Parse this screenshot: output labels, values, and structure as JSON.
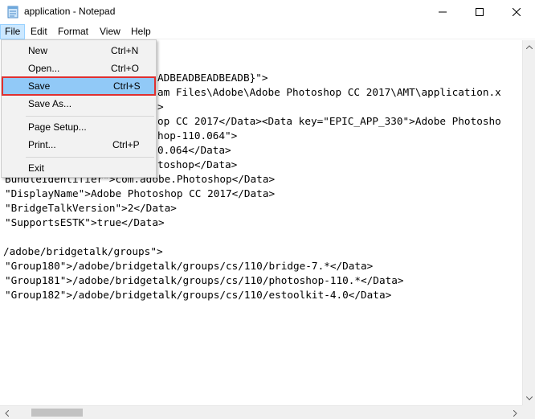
{
  "window": {
    "title": "application - Notepad"
  },
  "menubar": {
    "items": [
      {
        "label": "File"
      },
      {
        "label": "Edit"
      },
      {
        "label": "Format"
      },
      {
        "label": "View"
      },
      {
        "label": "Help"
      }
    ]
  },
  "file_menu": {
    "new": {
      "label": "New",
      "shortcut": "Ctrl+N"
    },
    "open": {
      "label": "Open...",
      "shortcut": "Ctrl+O"
    },
    "save": {
      "label": "Save",
      "shortcut": "Ctrl+S"
    },
    "save_as": {
      "label": "Save As..."
    },
    "page_setup": {
      "label": "Page Setup..."
    },
    "print": {
      "label": "Print...",
      "shortcut": "Ctrl+P"
    },
    "exit": {
      "label": "Exit"
    }
  },
  "editor": {
    "lines": [
      "ADBEADBEADBEADB}\">",
      "am Files\\Adobe\\Adobe Photoshop CC 2017\\AMT\\application.x",
      ">",
      "op CC 2017</Data><Data key=\"EPIC_APP_330\">Adobe Photosho",
      "hop-110.064\">",
      "0.064</Data>",
      "toshop</Data>",
      "BundleIdentifier\">com.adobe.Photoshop</Data>",
      "\"DisplayName\">Adobe Photoshop CC 2017</Data>",
      "\"BridgeTalkVersion\">2</Data>",
      "\"SupportsESTK\">true</Data>",
      "/adobe/bridgetalk/groups\">",
      "\"Group180\">/adobe/bridgetalk/groups/cs/110/bridge-7.*</Data>",
      "\"Group181\">/adobe/bridgetalk/groups/cs/110/photoshop-110.*</Data>",
      "\"Group182\">/adobe/bridgetalk/groups/cs/110/estoolkit-4.0</Data>"
    ]
  },
  "colors": {
    "menu_highlight": "#91c9f7",
    "highlight_outline": "#e03030",
    "active_menu": "#cce8ff"
  }
}
